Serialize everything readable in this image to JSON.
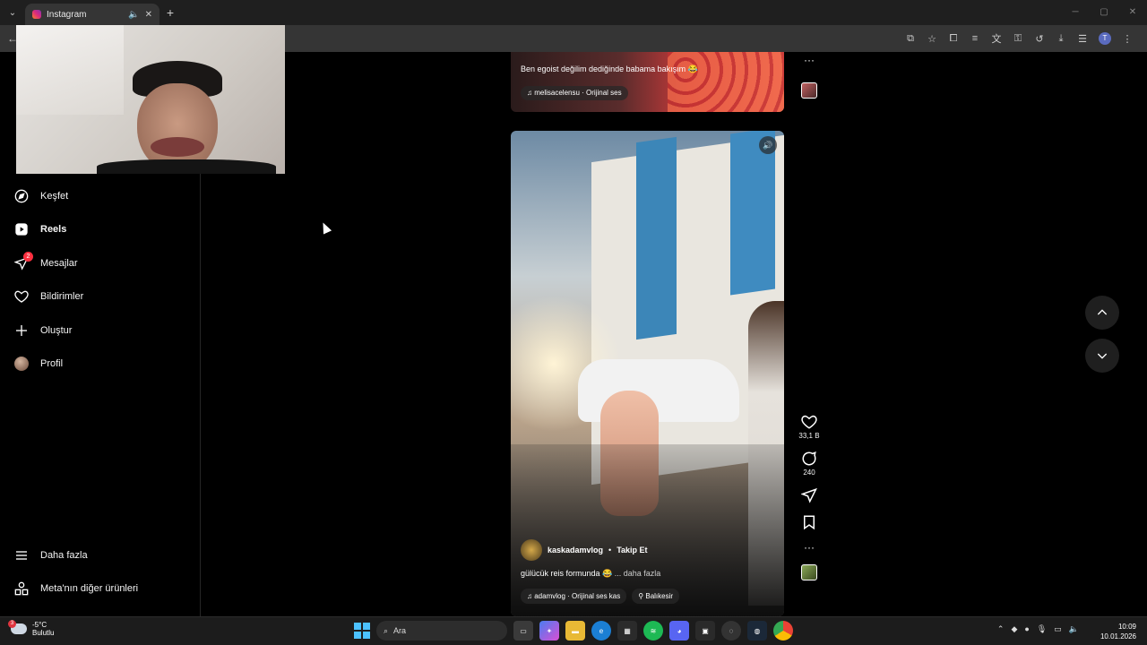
{
  "browser": {
    "tab_title": "Instagram",
    "tab_mute_icon": "speaker-icon",
    "new_tab_label": "+",
    "profile_initial": "T"
  },
  "sidebar": {
    "items": [
      {
        "label": "Keşfet",
        "icon": "compass-icon"
      },
      {
        "label": "Reels",
        "icon": "reels-icon"
      },
      {
        "label": "Mesajlar",
        "icon": "messenger-icon",
        "badge": "2"
      },
      {
        "label": "Bildirimler",
        "icon": "heart-icon"
      },
      {
        "label": "Oluştur",
        "icon": "plus-icon"
      },
      {
        "label": "Profil",
        "icon": "avatar"
      }
    ],
    "bottom": [
      {
        "label": "Daha fazla",
        "icon": "menu-icon"
      },
      {
        "label": "Meta'nın diğer ürünleri",
        "icon": "apps-icon"
      }
    ]
  },
  "reel_top": {
    "caption": "Ben egoist değilim dediğinde babama bakışım 😂",
    "music": "♫ melisacelensu · Orijinal ses"
  },
  "reel_main": {
    "author": "kaskadamvlog",
    "separator": "•",
    "follow_label": "Takip Et",
    "caption": "gülücük reis formunda 😂",
    "caption_more": "... daha fazla",
    "music": "♫ adamvlog · Orijinal ses   kas",
    "location": "Balıkesir"
  },
  "actions": {
    "likes": "33,1 B",
    "comments": "240"
  },
  "taskbar": {
    "temperature": "-5°C",
    "weather_desc": "Bulutlu",
    "weather_badge": "3",
    "search_placeholder": "Ara",
    "time": "10:09",
    "date": "10.01.2026"
  },
  "colors": {
    "badge_red": "#ff3040",
    "background": "#000000",
    "sidebar_border": "#262626"
  }
}
